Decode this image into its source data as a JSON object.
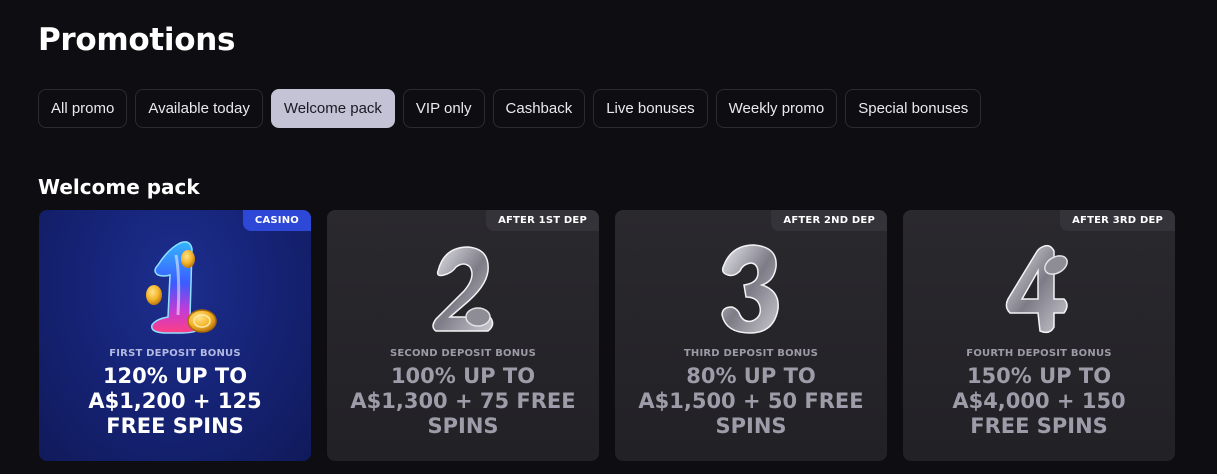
{
  "page": {
    "title": "Promotions"
  },
  "tabs": [
    {
      "label": "All promo",
      "active": false
    },
    {
      "label": "Available today",
      "active": false
    },
    {
      "label": "Welcome pack",
      "active": true
    },
    {
      "label": "VIP only",
      "active": false
    },
    {
      "label": "Cashback",
      "active": false
    },
    {
      "label": "Live bonuses",
      "active": false
    },
    {
      "label": "Weekly promo",
      "active": false
    },
    {
      "label": "Special bonuses",
      "active": false
    }
  ],
  "section": {
    "title": "Welcome pack"
  },
  "cards": [
    {
      "badge": "CASINO",
      "subtitle": "FIRST DEPOSIT BONUS",
      "main": "120% UP TO A$1,200 + 125 FREE SPINS",
      "icon": "number-one-coin-icon",
      "featured": true
    },
    {
      "badge": "AFTER 1ST DEP",
      "subtitle": "SECOND DEPOSIT BONUS",
      "main": "100% UP TO A$1,300 + 75 FREE SPINS",
      "icon": "number-two-icon",
      "featured": false
    },
    {
      "badge": "AFTER 2ND DEP",
      "subtitle": "THIRD DEPOSIT BONUS",
      "main": "80% UP TO A$1,500 + 50 FREE SPINS",
      "icon": "number-three-icon",
      "featured": false
    },
    {
      "badge": "AFTER 3RD DEP",
      "subtitle": "FOURTH DEPOSIT BONUS",
      "main": "150% UP TO A$4,000 + 150 FREE SPINS",
      "icon": "number-four-icon",
      "featured": false
    }
  ],
  "colors": {
    "background": "#0e0d11",
    "active_tab": "#c4c3d6",
    "featured_card": "#162478",
    "casino_badge": "#2d47d6",
    "coin": "#f4b52a"
  }
}
